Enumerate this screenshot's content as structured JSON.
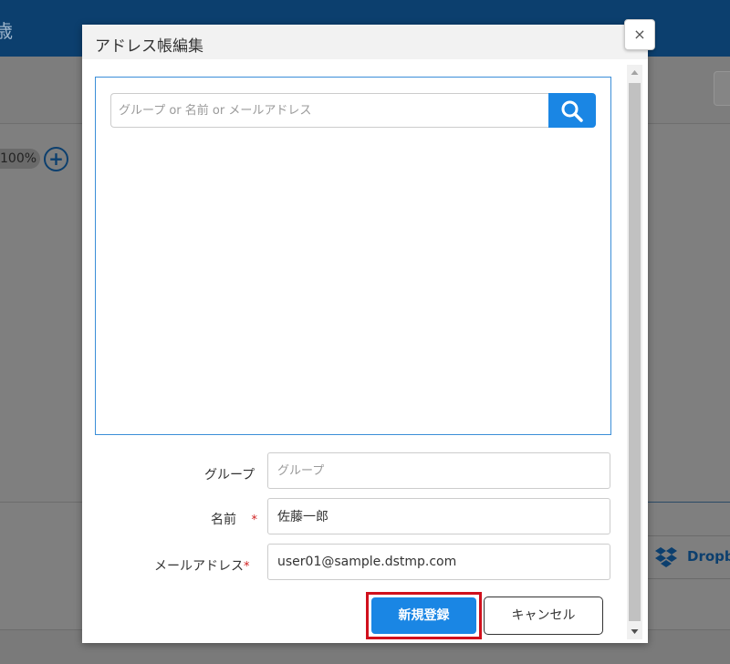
{
  "background": {
    "header_char": "歳",
    "zoom_value": "100%",
    "zoom_in_symbol": "+",
    "dropbox_label": "Dropbox"
  },
  "dialog": {
    "title": "アドレス帳編集",
    "close_symbol": "×",
    "search": {
      "placeholder": "グループ or 名前 or メールアドレス",
      "value": ""
    },
    "form": {
      "group": {
        "label": "グループ",
        "placeholder": "グループ",
        "value": ""
      },
      "name": {
        "label": "名前",
        "required_mark": "*",
        "value": "佐藤一郎"
      },
      "email": {
        "label": "メールアドレス",
        "required_mark": "*",
        "value": "user01@sample.dstmp.com"
      }
    },
    "buttons": {
      "register": "新規登録",
      "cancel": "キャンセル"
    }
  },
  "colors": {
    "primary": "#1a86e4",
    "header_bg": "#0c3f6e",
    "highlight": "#d0101c",
    "required": "#d02020"
  }
}
